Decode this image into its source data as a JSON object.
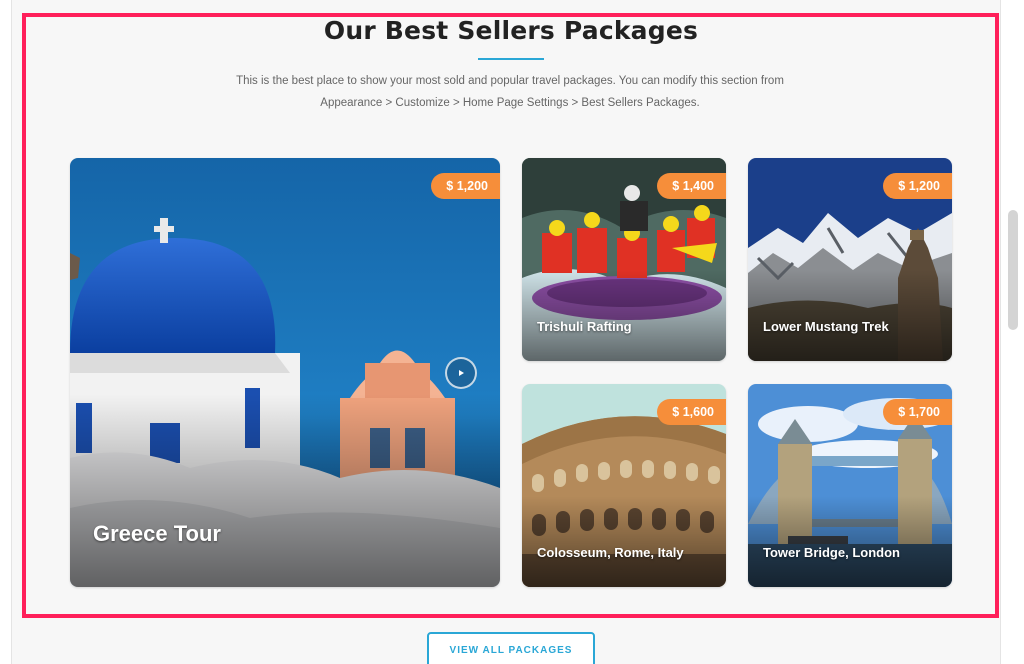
{
  "section": {
    "title": "Our Best Sellers Packages",
    "description": "This is the best place to show your most sold and popular travel packages. You can modify this section from Appearance > Customize > Home Page Settings > Best Sellers Packages."
  },
  "packages": [
    {
      "title": "Greece Tour",
      "price": "$ 1,200"
    },
    {
      "title": "Trishuli Rafting",
      "price": "$ 1,400"
    },
    {
      "title": "Lower Mustang Trek",
      "price": "$ 1,200"
    },
    {
      "title": "Colosseum, Rome, Italy",
      "price": "$ 1,600"
    },
    {
      "title": "Tower Bridge, London",
      "price": "$ 1,700"
    }
  ],
  "cta": {
    "label": "VIEW ALL PACKAGES"
  },
  "colors": {
    "accent": "#2aa7d6",
    "price_badge": "#f68e3a",
    "highlight": "#ff1f5a"
  },
  "icons": {
    "slider_next": "play-arrow-icon"
  }
}
